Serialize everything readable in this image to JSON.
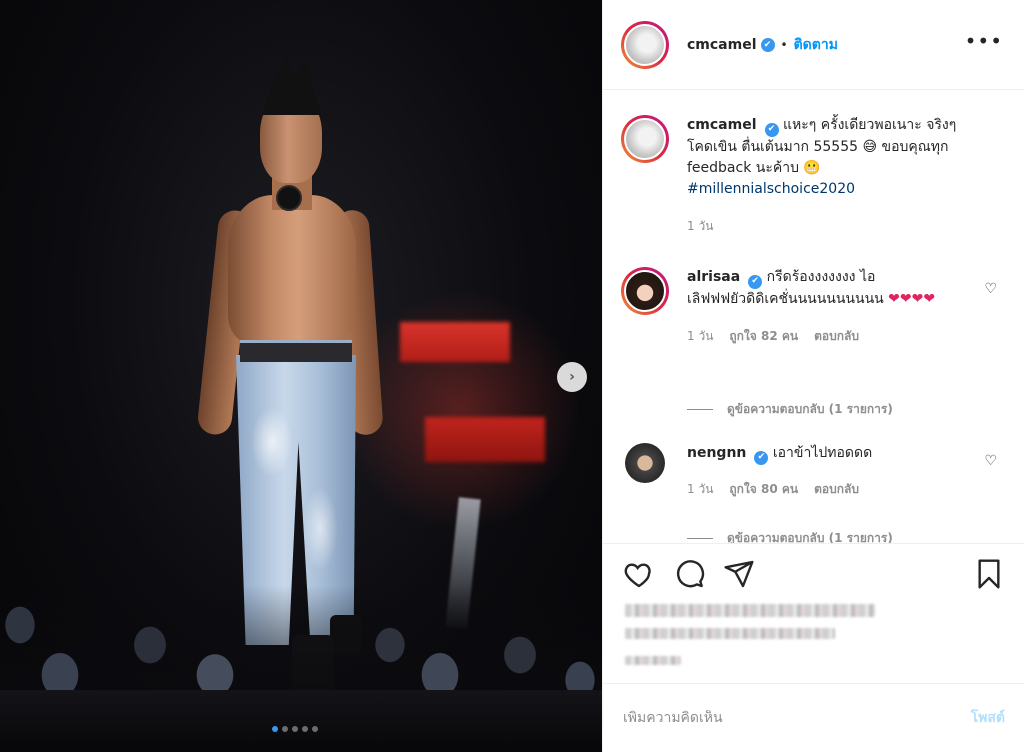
{
  "post": {
    "carousel": {
      "slide_count": 5,
      "active_index": 0,
      "next_glyph": "›"
    },
    "author": {
      "username": "cmcamel",
      "verified": true,
      "follow_separator": "•",
      "follow_label": "ติดตาม",
      "more_glyph": "•••"
    }
  },
  "caption": {
    "username": "cmcamel",
    "text_1": "แหะๆ ครั้งเดียวพอเนาะ จริงๆ โคดเขิน ตื่นเต้นมาก 55555",
    "emoji_1": "😅",
    "text_2": "ขอบคุณทุก feedback นะค้าบ",
    "emoji_2": "😬",
    "hashtag": "#millennialschoice2020",
    "time": "1 วัน"
  },
  "comments": [
    {
      "username": "alrisaa",
      "verified": true,
      "text": "กรีดร้องงงงงงง ไอเลิฟฟฟยัวดิดิเคชั่นนนนนนนนนน",
      "emojis": "❤❤❤❤",
      "time": "1 วัน",
      "likes": "ถูกใจ 82 คน",
      "reply_label": "ตอบกลับ",
      "view_replies": "ดูข้อความตอบกลับ (1 รายการ)",
      "like_glyph": "♡"
    },
    {
      "username": "nengnn",
      "verified": true,
      "text": "เอาข้าไปทอดดด",
      "time": "1 วัน",
      "likes": "ถูกใจ 80 คน",
      "reply_label": "ตอบกลับ",
      "view_replies": "ดูข้อความตอบกลับ (1 รายการ)",
      "like_glyph": "♡"
    }
  ],
  "actions": {
    "like": "heart-outline-icon",
    "comment": "speech-bubble-icon",
    "share": "paper-plane-icon",
    "save": "bookmark-icon"
  },
  "add_comment": {
    "placeholder": "เพิ่มความคิดเห็น",
    "post_label": "โพสต์"
  },
  "colors": {
    "link": "#0095f6",
    "verified": "#3897f0",
    "heart": "#e0245e",
    "muted": "#8e8e8e",
    "post_disabled": "#b2dffc"
  }
}
